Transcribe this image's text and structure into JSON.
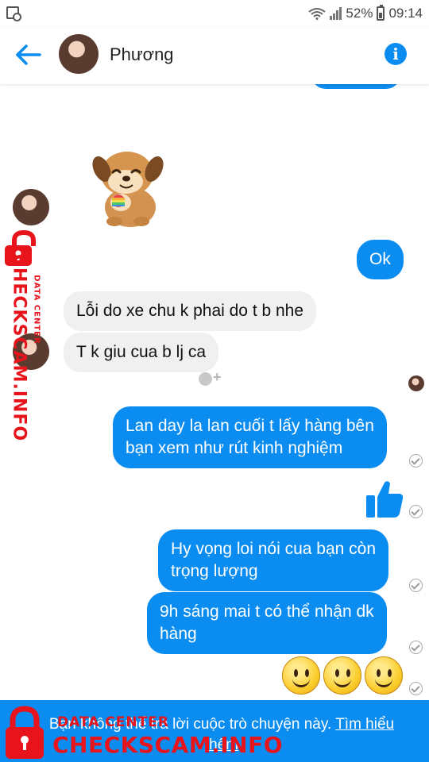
{
  "status_bar": {
    "battery": "52%",
    "time": "09:14"
  },
  "header": {
    "contact_name": "Phương",
    "icons": [
      "back-arrow-icon",
      "info-icon"
    ]
  },
  "messages": [
    {
      "side": "in",
      "type": "sticker",
      "sticker": "dog-holding-rainbow-heart"
    },
    {
      "side": "out",
      "text": "Ok"
    },
    {
      "side": "in",
      "text": "Lỗi do xe chu k phai do t b nhe"
    },
    {
      "side": "in",
      "text": "T k giu cua b lj ca"
    },
    {
      "side": "out",
      "text": "Lan day la lan cuối t lấy hàng bên\nbạn xem như rút kinh nghiệm"
    },
    {
      "side": "out",
      "type": "emoji",
      "emoji": "thumbs-up"
    },
    {
      "side": "out",
      "text": "Hy vọng loi nói cua bạn còn\ntrọng lượng"
    },
    {
      "side": "out",
      "text": "9h sáng mai t có thể nhận dk\nhàng"
    },
    {
      "side": "out",
      "type": "emoji",
      "emoji": "smiley",
      "count": 3
    }
  ],
  "footer": {
    "notice": "Bạn không thể trả lời cuộc trò chuyện này.",
    "link": "Tìm hiểu thêm"
  },
  "watermark": {
    "small": "DATA CENTER",
    "big": "CHECKSCAM.INFO",
    "color": "#e8141c"
  },
  "colors": {
    "accent": "#0a8cf0",
    "incoming_bubble": "#f1f0f0"
  }
}
